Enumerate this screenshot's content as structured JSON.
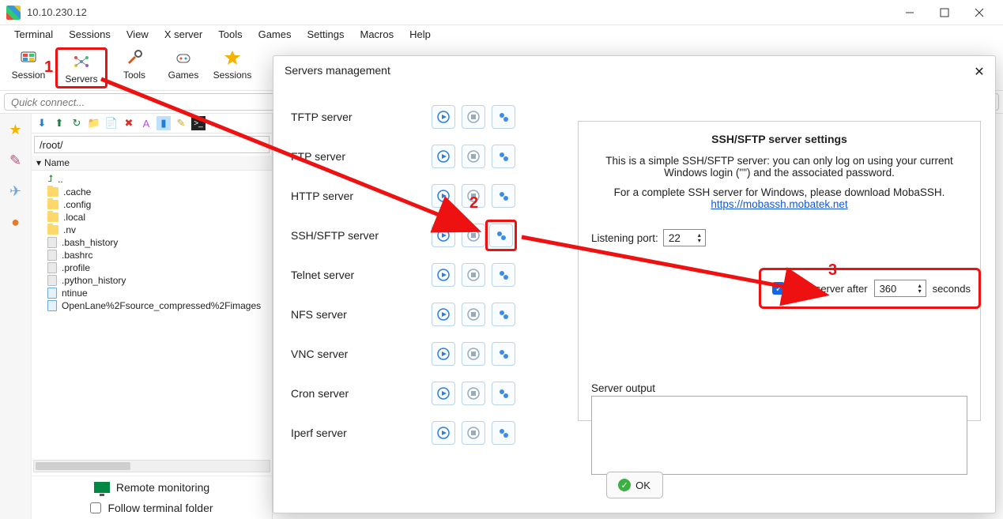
{
  "window": {
    "title": "10.10.230.12"
  },
  "menus": [
    "Terminal",
    "Sessions",
    "View",
    "X server",
    "Tools",
    "Games",
    "Settings",
    "Macros",
    "Help"
  ],
  "toolbar": {
    "session": "Session",
    "servers": "Servers",
    "tools": "Tools",
    "games": "Games",
    "sessions": "Sessions"
  },
  "quick_connect_placeholder": "Quick connect...",
  "sidebar": {
    "path": "/root/",
    "header": "Name",
    "items": [
      {
        "icon": "up",
        "name": ".."
      },
      {
        "icon": "folder",
        "name": ".cache"
      },
      {
        "icon": "folder",
        "name": ".config"
      },
      {
        "icon": "folder",
        "name": ".local"
      },
      {
        "icon": "folder",
        "name": ".nv"
      },
      {
        "icon": "file",
        "name": ".bash_history"
      },
      {
        "icon": "file",
        "name": ".bashrc"
      },
      {
        "icon": "file",
        "name": ".profile"
      },
      {
        "icon": "file",
        "name": ".python_history"
      },
      {
        "icon": "bluefile",
        "name": "ntinue"
      },
      {
        "icon": "bluefile",
        "name": "OpenLane%2Fsource_compressed%2Fimages"
      }
    ],
    "remote_monitoring": "Remote monitoring",
    "follow_terminal": "Follow terminal folder"
  },
  "popup": {
    "title": "Servers management",
    "servers": [
      "TFTP server",
      "FTP server",
      "HTTP server",
      "SSH/SFTP server",
      "Telnet server",
      "NFS server",
      "VNC server",
      "Cron server",
      "Iperf server"
    ],
    "settings": {
      "heading": "SSH/SFTP server settings",
      "desc1": "This is a simple SSH/SFTP server: you can only log on using your current Windows login (\"\") and the associated password.",
      "desc2": "For a complete SSH server for Windows, please download MobaSSH.",
      "link": "https://mobassh.mobatek.net",
      "port_label": "Listening port:",
      "port_value": "22",
      "stop_label": "Stop server after",
      "stop_value": "360",
      "stop_unit": "seconds",
      "output_label": "Server output"
    },
    "ok": "OK"
  },
  "annotations": {
    "one": "1",
    "two": "2",
    "three": "3"
  }
}
